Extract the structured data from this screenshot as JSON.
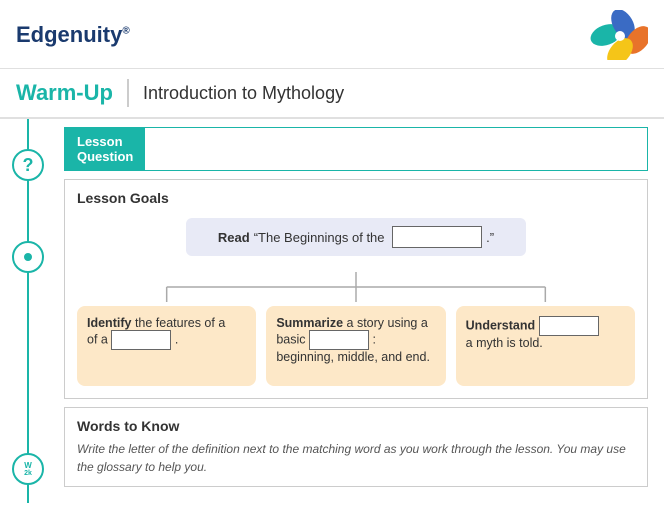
{
  "header": {
    "logo": "Edgenuity",
    "logo_tm": "®"
  },
  "warmup": {
    "label": "Warm-Up",
    "divider": true,
    "title": "Introduction to Mythology"
  },
  "sidebar": {
    "icons": [
      {
        "id": "question",
        "type": "question",
        "label": "?"
      },
      {
        "id": "circle",
        "type": "circle-dot",
        "label": ""
      },
      {
        "id": "w2k",
        "type": "w2k",
        "label": "W2k"
      }
    ]
  },
  "lesson_question": {
    "tab_label": "Lesson\nQuestion"
  },
  "lesson_goals": {
    "heading": "Lesson Goals",
    "read_prefix": "Read ",
    "read_quote_start": "“The Beginnings of the ",
    "read_fill": "",
    "read_quote_end": ".”",
    "goal1": {
      "bold": "Identify",
      "text1": " the features of a ",
      "fill": "",
      "text2": "."
    },
    "goal2": {
      "bold": "Summarize",
      "text1": " a story using a basic ",
      "fill": "",
      "text2": ": beginning, middle, and end."
    },
    "goal3": {
      "bold": "Understand",
      "text1": " ",
      "fill": "",
      "text2": " a myth is told."
    }
  },
  "words_to_know": {
    "heading": "Words to Know",
    "description": "Write the letter of the definition next to the matching word as you work through the lesson. You may use the glossary to help you."
  }
}
